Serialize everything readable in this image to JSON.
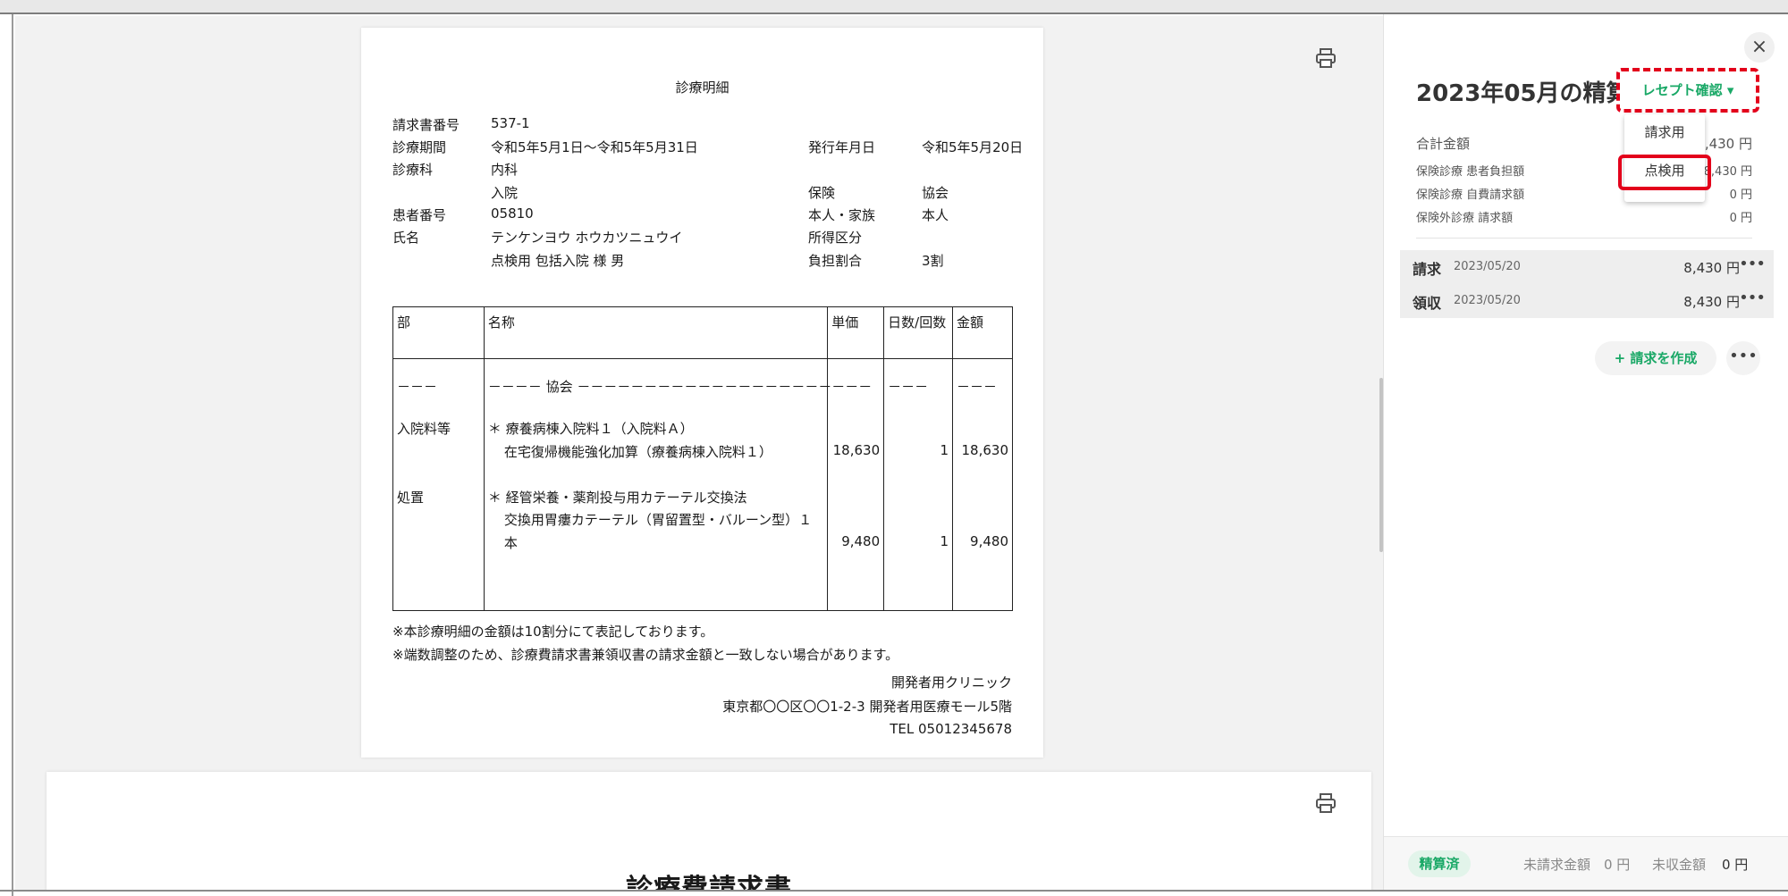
{
  "window": {
    "faint_title": ""
  },
  "doc": {
    "title": "診療明細",
    "fields": {
      "invoice_no_label": "請求書番号",
      "invoice_no": "537-1",
      "period_label": "診療期間",
      "period": "令和5年5月1日～令和5年5月31日",
      "issue_label": "発行年月日",
      "issue": "令和5年5月20日",
      "dept_label": "診療科",
      "dept": "内科",
      "admission": "入院",
      "insurance_label": "保険",
      "insurance": "協会",
      "patient_no_label": "患者番号",
      "patient_no": "05810",
      "relation_label": "本人・家族",
      "relation": "本人",
      "name_label": "氏名",
      "name_kana": "テンケンヨウ ホウカツニュウイ",
      "income_label": "所得区分",
      "name_kanji": "点検用 包括入院 様 男",
      "burden_label": "負担割合",
      "burden": "3割"
    },
    "table": {
      "headers": [
        "部",
        "名称",
        "単価",
        "日数/回数",
        "金額"
      ],
      "dash_row": {
        "part": "－－－",
        "name": "－－－－ 協会 －－－－－－－－－－－－－－－－－－－",
        "price": "－－－",
        "days": "－－－",
        "amount": "－－－"
      },
      "rows": [
        {
          "part": "入院料等",
          "line1": "＊ 療養病棟入院料１（入院料Ａ）",
          "line2": "在宅復帰機能強化加算（療養病棟入院料１）",
          "price": "18,630",
          "days": "1",
          "amount": "18,630"
        },
        {
          "part": "処置",
          "line1": "＊ 経管栄養・薬剤投与用カテーテル交換法",
          "line2": "交換用胃瘻カテーテル（胃留置型・バルーン型）１",
          "line3": "本",
          "price": "9,480",
          "days": "1",
          "amount": "9,480"
        }
      ]
    },
    "notes": [
      "※本診療明細の金額は10割分にて表記しております。",
      "※端数調整のため、診療費請求書兼領収書の請求金額と一致しない場合があります。"
    ],
    "clinic": {
      "name": "開発者用クリニック",
      "address": "東京都〇〇区〇〇1-2-3 開発者用医療モール5階",
      "tel": "TEL 05012345678"
    }
  },
  "doc2": {
    "title": "診療費請求書"
  },
  "panel": {
    "title": "2023年05月の精算",
    "receipt_button": "レセプト確認 ▾",
    "dropdown": [
      "請求用",
      "点検用"
    ],
    "summary": [
      {
        "label": "合計金額",
        "value": "8,430 円"
      },
      {
        "label": "保険診療 患者負担額",
        "value": "8,430 円"
      },
      {
        "label": "保険診療 自費請求額",
        "value": "0 円"
      },
      {
        "label": "保険外診療 請求額",
        "value": "0 円"
      }
    ],
    "transactions": [
      {
        "label": "請求",
        "date": "2023/05/20",
        "amount": "8,430 円"
      },
      {
        "label": "領収",
        "date": "2023/05/20",
        "amount": "8,430 円"
      }
    ],
    "create_button": "+ 請求を作成",
    "more": "•••",
    "footer": {
      "badge": "精算済",
      "unbilled_label": "未請求金額",
      "unbilled": "0 円",
      "uncollected_label": "未収金額",
      "uncollected": "0 円"
    }
  },
  "icons": {
    "close": "close-icon",
    "print": "printer-icon"
  }
}
